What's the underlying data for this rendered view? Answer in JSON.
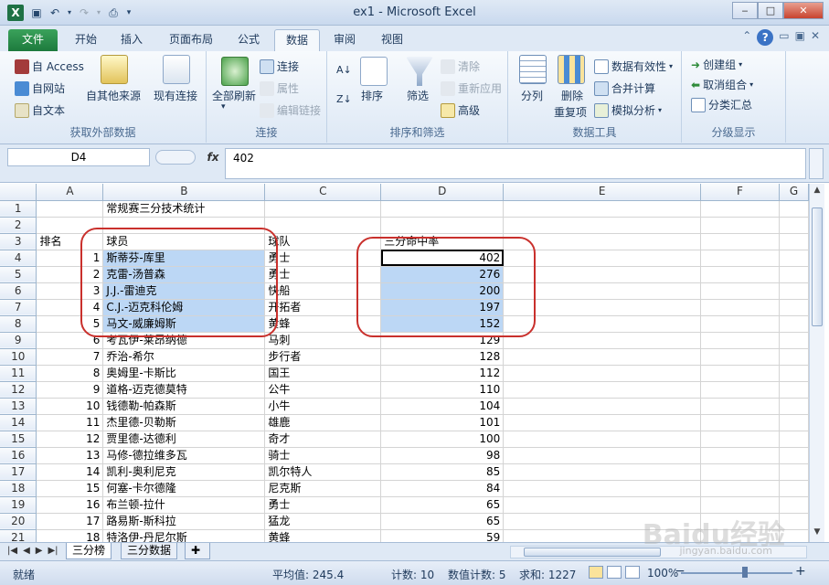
{
  "window": {
    "title": "ex1 - Microsoft Excel",
    "app_icon": "X",
    "minimize": "‒",
    "maximize": "□",
    "close": "✕"
  },
  "ribbon_tabs": {
    "file": "文件",
    "items": [
      "开始",
      "插入",
      "页面布局",
      "公式",
      "数据",
      "审阅",
      "视图"
    ],
    "active": "数据",
    "help": "?"
  },
  "ribbon": {
    "external": {
      "access": "自 Access",
      "web": "自网站",
      "text": "自文本",
      "other": "自其他来源",
      "existing": "现有连接",
      "label": "获取外部数据"
    },
    "connections": {
      "refresh": "全部刷新",
      "connections": "连接",
      "properties": "属性",
      "edit_links": "编辑链接",
      "label": "连接"
    },
    "sort_filter": {
      "sort": "排序",
      "filter": "筛选",
      "clear": "清除",
      "reapply": "重新应用",
      "advanced": "高级",
      "label": "排序和筛选"
    },
    "data_tools": {
      "text_to_columns": "分列",
      "remove_dup_1": "删除",
      "remove_dup_2": "重复项",
      "validation": "数据有效性",
      "consolidate": "合并计算",
      "whatif": "模拟分析",
      "label": "数据工具"
    },
    "outline": {
      "group": "创建组",
      "ungroup": "取消组合",
      "subtotal": "分类汇总",
      "label": "分级显示"
    }
  },
  "formula_bar": {
    "name_box": "D4",
    "fx": "fx",
    "value": "402"
  },
  "columns": [
    "A",
    "B",
    "C",
    "D",
    "E",
    "F",
    "G"
  ],
  "rows": [
    {
      "n": "1",
      "a": "",
      "b": "常规赛三分技术统计",
      "c": "",
      "d": ""
    },
    {
      "n": "2",
      "a": "",
      "b": "",
      "c": "",
      "d": ""
    },
    {
      "n": "3",
      "a": "排名",
      "b": "球员",
      "c": "球队",
      "d": "三分命中率"
    },
    {
      "n": "4",
      "a": "1",
      "b": "斯蒂芬-库里",
      "c": "勇士",
      "d": "402"
    },
    {
      "n": "5",
      "a": "2",
      "b": "克雷-汤普森",
      "c": "勇士",
      "d": "276"
    },
    {
      "n": "6",
      "a": "3",
      "b": "J.J.-雷迪克",
      "c": "快船",
      "d": "200"
    },
    {
      "n": "7",
      "a": "4",
      "b": "C.J.-迈克科伦姆",
      "c": "开拓者",
      "d": "197"
    },
    {
      "n": "8",
      "a": "5",
      "b": "马文-威廉姆斯",
      "c": "黄蜂",
      "d": "152"
    },
    {
      "n": "9",
      "a": "6",
      "b": "考瓦伊-莱昂纳德",
      "c": "马刺",
      "d": "129"
    },
    {
      "n": "10",
      "a": "7",
      "b": "乔治-希尔",
      "c": "步行者",
      "d": "128"
    },
    {
      "n": "11",
      "a": "8",
      "b": "奥姆里-卡斯比",
      "c": "国王",
      "d": "112"
    },
    {
      "n": "12",
      "a": "9",
      "b": "道格-迈克德莫特",
      "c": "公牛",
      "d": "110"
    },
    {
      "n": "13",
      "a": "10",
      "b": "钱德勒-帕森斯",
      "c": "小牛",
      "d": "104"
    },
    {
      "n": "14",
      "a": "11",
      "b": "杰里德-贝勒斯",
      "c": "雄鹿",
      "d": "101"
    },
    {
      "n": "15",
      "a": "12",
      "b": "贾里德-达德利",
      "c": "奇才",
      "d": "100"
    },
    {
      "n": "16",
      "a": "13",
      "b": "马修-德拉维多瓦",
      "c": "骑士",
      "d": "98"
    },
    {
      "n": "17",
      "a": "14",
      "b": "凯利-奥利尼克",
      "c": "凯尔特人",
      "d": "85"
    },
    {
      "n": "18",
      "a": "15",
      "b": "何塞-卡尔德隆",
      "c": "尼克斯",
      "d": "84"
    },
    {
      "n": "19",
      "a": "16",
      "b": "布兰顿-拉什",
      "c": "勇士",
      "d": "65"
    },
    {
      "n": "20",
      "a": "17",
      "b": "路易斯-斯科拉",
      "c": "猛龙",
      "d": "65"
    },
    {
      "n": "21",
      "a": "18",
      "b": "特洛伊-丹尼尔斯",
      "c": "黄蜂",
      "d": "59"
    }
  ],
  "sheet_tabs": [
    "三分榜",
    "三分数据"
  ],
  "status": {
    "ready": "就绪",
    "average": "平均值: 245.4",
    "count": "计数: 10",
    "numcount": "数值计数: 5",
    "sum": "求和: 1227",
    "zoom": "100%",
    "zoom_minus": "−",
    "zoom_plus": "+"
  },
  "watermark": {
    "logo": "Baidu经验",
    "url": "jingyan.baidu.com"
  },
  "colors": {
    "selection": "#bcd7f5",
    "annotation": "#c9302c",
    "file_tab": "#1d7a3d"
  }
}
